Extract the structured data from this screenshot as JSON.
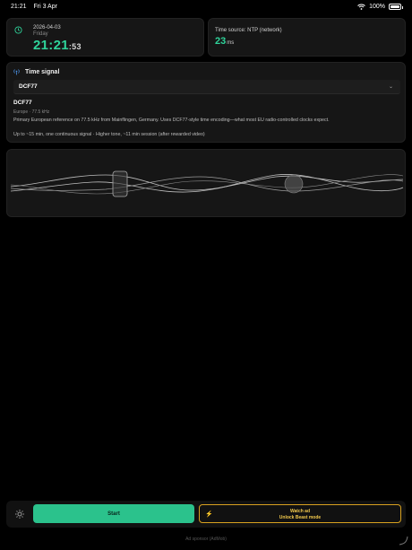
{
  "status_bar": {
    "time": "21:21",
    "date": "Fri 3 Apr",
    "battery": "100%",
    "battery_level": 1.0
  },
  "clock": {
    "date": "2026-04-03",
    "weekday": "Friday",
    "hm": "21:21",
    "seconds": ":53"
  },
  "time_source": {
    "label": "Time source: NTP (network)",
    "offset_value": "23",
    "offset_unit": "ms"
  },
  "time_signal": {
    "title": "Time signal",
    "selected": "DCF77",
    "name": "DCF77",
    "meta": "Europe · 77.5 kHz",
    "description": "Primary European reference on 77.5 kHz from Mainflingen, Germany. Uses DCF77-style time encoding—what most EU radio-controlled clocks expect.",
    "info": "Up to ~15 min, one continuous signal · Higher tone, ~11 min session (after rewarded video)"
  },
  "controls": {
    "start_label": "Start",
    "ad_line1": "Watch ad",
    "ad_line2": "Unlock Beast mode"
  },
  "footer": {
    "sponsor": "Ad sponsor (AdMob)"
  },
  "colors": {
    "accent": "#2fd39a",
    "start": "#2bc28c",
    "gold": "#d9a21f"
  },
  "icons": {
    "wifi": "wifi-icon",
    "clock": "clock-icon",
    "signal": "antenna-icon",
    "gear": "gear-icon",
    "bolt": "bolt-icon",
    "chevron": "chevron-down-icon"
  }
}
